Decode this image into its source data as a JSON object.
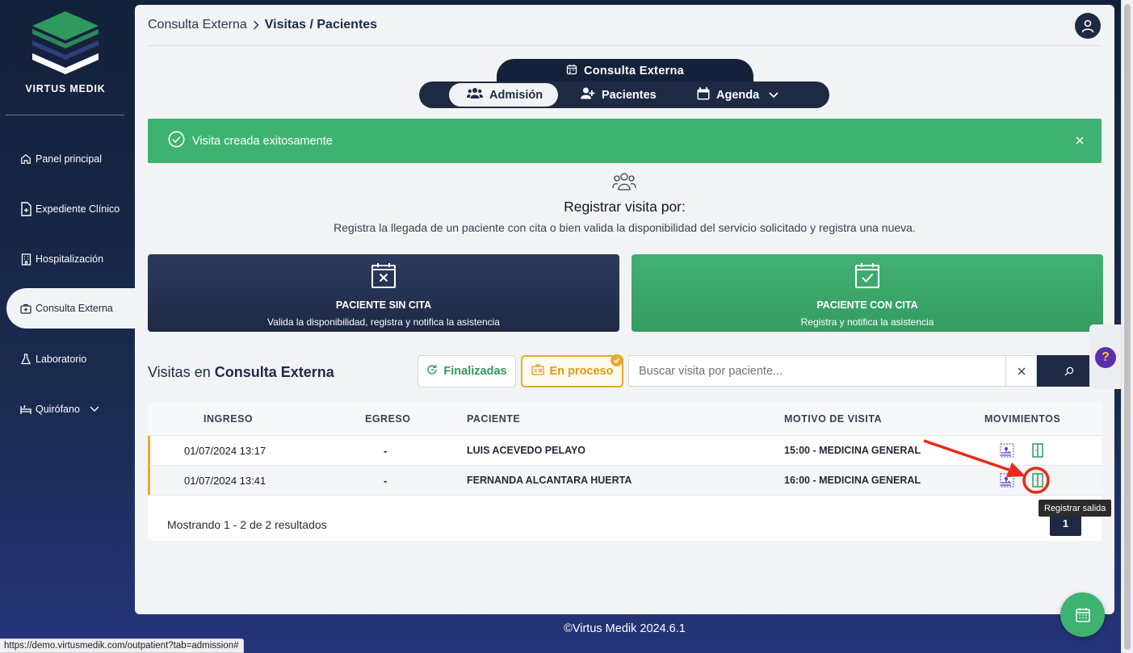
{
  "brand": {
    "name": "VIRTUS MEDIK"
  },
  "sidebar": {
    "items": [
      {
        "label": "Panel principal",
        "icon": "home-icon"
      },
      {
        "label": "Expediente Clínico",
        "icon": "file-plus-icon"
      },
      {
        "label": "Hospitalización",
        "icon": "building-icon"
      },
      {
        "label": "Consulta Externa",
        "icon": "briefcase-medical-icon",
        "active": true
      },
      {
        "label": "Laboratorio",
        "icon": "flask-icon"
      },
      {
        "label": "Quirófano",
        "icon": "bed-icon",
        "has_submenu": true
      }
    ]
  },
  "header": {
    "breadcrumb": [
      "Consulta Externa",
      "Visitas / Pacientes"
    ]
  },
  "module": {
    "title": "Consulta Externa",
    "tabs": [
      {
        "label": "Admisión",
        "icon": "users-icon",
        "active": true
      },
      {
        "label": "Pacientes",
        "icon": "user-plus-icon"
      },
      {
        "label": "Agenda",
        "icon": "calendar-icon",
        "dropdown": true
      }
    ]
  },
  "alert": {
    "message": "Visita creada exitosamente",
    "color": "#3eb371"
  },
  "register": {
    "title": "Registrar visita por:",
    "description": "Registra la llegada de un paciente con cita o bien valida la disponibilidad del servicio solicitado y registra una nueva.",
    "cards": [
      {
        "title": "PACIENTE SIN CITA",
        "subtitle": "Valida la disponibilidad, registra y notifica la asistencia",
        "icon": "calendar-x-icon"
      },
      {
        "title": "PACIENTE CON CITA",
        "subtitle": "Registra y notifica la asistencia",
        "icon": "calendar-check-icon"
      }
    ]
  },
  "visits": {
    "title_prefix": "Visitas en",
    "title_bold": "Consulta Externa",
    "filters": [
      {
        "label": "Finalizadas",
        "icon": "refresh-icon"
      },
      {
        "label": "En proceso",
        "icon": "id-card-icon",
        "selected": true
      }
    ],
    "search": {
      "placeholder": "Buscar visita por paciente...",
      "value": ""
    },
    "columns": [
      "INGRESO",
      "EGRESO",
      "PACIENTE",
      "MOTIVO DE VISITA",
      "MOVIMIENTOS"
    ],
    "rows": [
      {
        "ingreso": "01/07/2024 13:17",
        "egreso": "-",
        "paciente": "LUIS ACEVEDO PELAYO",
        "motivo": "15:00 - MEDICINA GENERAL"
      },
      {
        "ingreso": "01/07/2024 13:41",
        "egreso": "-",
        "paciente": "FERNANDA ALCANTARA HUERTA",
        "motivo": "16:00 - MEDICINA GENERAL"
      }
    ],
    "footer": "Mostrando 1 - 2 de 2 resultados",
    "page": "1",
    "tooltip": "Registrar salida"
  },
  "help": {
    "label": "?"
  },
  "copyright": "©Virtus Medik 2024.6.1",
  "status_url": "https://demo.virtusmedik.com/outpatient?tab=admission#",
  "colors": {
    "navy": "#1e2a44",
    "green": "#3eb371",
    "amber": "#e9ab2b",
    "annotation": "#e8291c"
  }
}
